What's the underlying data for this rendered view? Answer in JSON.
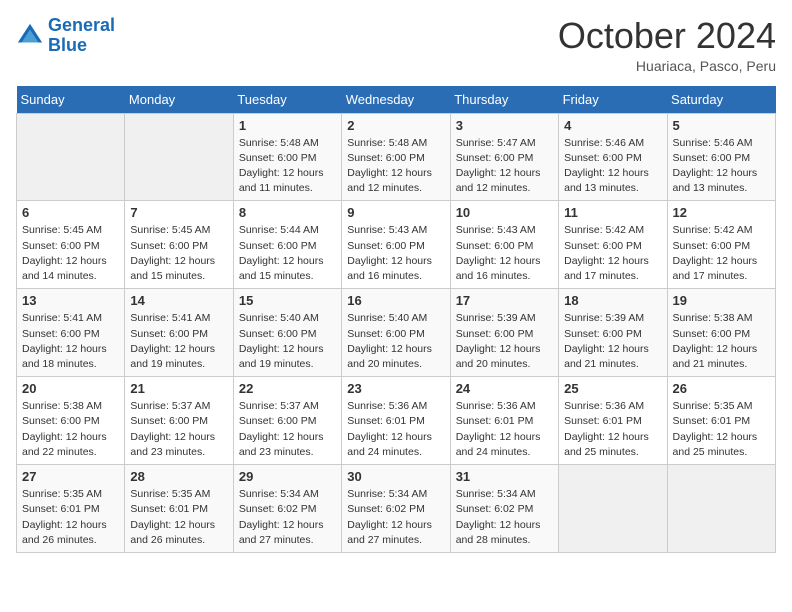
{
  "logo": {
    "line1": "General",
    "line2": "Blue"
  },
  "title": "October 2024",
  "subtitle": "Huariaca, Pasco, Peru",
  "days_header": [
    "Sunday",
    "Monday",
    "Tuesday",
    "Wednesday",
    "Thursday",
    "Friday",
    "Saturday"
  ],
  "weeks": [
    [
      {
        "num": "",
        "sunrise": "",
        "sunset": "",
        "daylight": ""
      },
      {
        "num": "",
        "sunrise": "",
        "sunset": "",
        "daylight": ""
      },
      {
        "num": "1",
        "sunrise": "Sunrise: 5:48 AM",
        "sunset": "Sunset: 6:00 PM",
        "daylight": "Daylight: 12 hours and 11 minutes."
      },
      {
        "num": "2",
        "sunrise": "Sunrise: 5:48 AM",
        "sunset": "Sunset: 6:00 PM",
        "daylight": "Daylight: 12 hours and 12 minutes."
      },
      {
        "num": "3",
        "sunrise": "Sunrise: 5:47 AM",
        "sunset": "Sunset: 6:00 PM",
        "daylight": "Daylight: 12 hours and 12 minutes."
      },
      {
        "num": "4",
        "sunrise": "Sunrise: 5:46 AM",
        "sunset": "Sunset: 6:00 PM",
        "daylight": "Daylight: 12 hours and 13 minutes."
      },
      {
        "num": "5",
        "sunrise": "Sunrise: 5:46 AM",
        "sunset": "Sunset: 6:00 PM",
        "daylight": "Daylight: 12 hours and 13 minutes."
      }
    ],
    [
      {
        "num": "6",
        "sunrise": "Sunrise: 5:45 AM",
        "sunset": "Sunset: 6:00 PM",
        "daylight": "Daylight: 12 hours and 14 minutes."
      },
      {
        "num": "7",
        "sunrise": "Sunrise: 5:45 AM",
        "sunset": "Sunset: 6:00 PM",
        "daylight": "Daylight: 12 hours and 15 minutes."
      },
      {
        "num": "8",
        "sunrise": "Sunrise: 5:44 AM",
        "sunset": "Sunset: 6:00 PM",
        "daylight": "Daylight: 12 hours and 15 minutes."
      },
      {
        "num": "9",
        "sunrise": "Sunrise: 5:43 AM",
        "sunset": "Sunset: 6:00 PM",
        "daylight": "Daylight: 12 hours and 16 minutes."
      },
      {
        "num": "10",
        "sunrise": "Sunrise: 5:43 AM",
        "sunset": "Sunset: 6:00 PM",
        "daylight": "Daylight: 12 hours and 16 minutes."
      },
      {
        "num": "11",
        "sunrise": "Sunrise: 5:42 AM",
        "sunset": "Sunset: 6:00 PM",
        "daylight": "Daylight: 12 hours and 17 minutes."
      },
      {
        "num": "12",
        "sunrise": "Sunrise: 5:42 AM",
        "sunset": "Sunset: 6:00 PM",
        "daylight": "Daylight: 12 hours and 17 minutes."
      }
    ],
    [
      {
        "num": "13",
        "sunrise": "Sunrise: 5:41 AM",
        "sunset": "Sunset: 6:00 PM",
        "daylight": "Daylight: 12 hours and 18 minutes."
      },
      {
        "num": "14",
        "sunrise": "Sunrise: 5:41 AM",
        "sunset": "Sunset: 6:00 PM",
        "daylight": "Daylight: 12 hours and 19 minutes."
      },
      {
        "num": "15",
        "sunrise": "Sunrise: 5:40 AM",
        "sunset": "Sunset: 6:00 PM",
        "daylight": "Daylight: 12 hours and 19 minutes."
      },
      {
        "num": "16",
        "sunrise": "Sunrise: 5:40 AM",
        "sunset": "Sunset: 6:00 PM",
        "daylight": "Daylight: 12 hours and 20 minutes."
      },
      {
        "num": "17",
        "sunrise": "Sunrise: 5:39 AM",
        "sunset": "Sunset: 6:00 PM",
        "daylight": "Daylight: 12 hours and 20 minutes."
      },
      {
        "num": "18",
        "sunrise": "Sunrise: 5:39 AM",
        "sunset": "Sunset: 6:00 PM",
        "daylight": "Daylight: 12 hours and 21 minutes."
      },
      {
        "num": "19",
        "sunrise": "Sunrise: 5:38 AM",
        "sunset": "Sunset: 6:00 PM",
        "daylight": "Daylight: 12 hours and 21 minutes."
      }
    ],
    [
      {
        "num": "20",
        "sunrise": "Sunrise: 5:38 AM",
        "sunset": "Sunset: 6:00 PM",
        "daylight": "Daylight: 12 hours and 22 minutes."
      },
      {
        "num": "21",
        "sunrise": "Sunrise: 5:37 AM",
        "sunset": "Sunset: 6:00 PM",
        "daylight": "Daylight: 12 hours and 23 minutes."
      },
      {
        "num": "22",
        "sunrise": "Sunrise: 5:37 AM",
        "sunset": "Sunset: 6:00 PM",
        "daylight": "Daylight: 12 hours and 23 minutes."
      },
      {
        "num": "23",
        "sunrise": "Sunrise: 5:36 AM",
        "sunset": "Sunset: 6:01 PM",
        "daylight": "Daylight: 12 hours and 24 minutes."
      },
      {
        "num": "24",
        "sunrise": "Sunrise: 5:36 AM",
        "sunset": "Sunset: 6:01 PM",
        "daylight": "Daylight: 12 hours and 24 minutes."
      },
      {
        "num": "25",
        "sunrise": "Sunrise: 5:36 AM",
        "sunset": "Sunset: 6:01 PM",
        "daylight": "Daylight: 12 hours and 25 minutes."
      },
      {
        "num": "26",
        "sunrise": "Sunrise: 5:35 AM",
        "sunset": "Sunset: 6:01 PM",
        "daylight": "Daylight: 12 hours and 25 minutes."
      }
    ],
    [
      {
        "num": "27",
        "sunrise": "Sunrise: 5:35 AM",
        "sunset": "Sunset: 6:01 PM",
        "daylight": "Daylight: 12 hours and 26 minutes."
      },
      {
        "num": "28",
        "sunrise": "Sunrise: 5:35 AM",
        "sunset": "Sunset: 6:01 PM",
        "daylight": "Daylight: 12 hours and 26 minutes."
      },
      {
        "num": "29",
        "sunrise": "Sunrise: 5:34 AM",
        "sunset": "Sunset: 6:02 PM",
        "daylight": "Daylight: 12 hours and 27 minutes."
      },
      {
        "num": "30",
        "sunrise": "Sunrise: 5:34 AM",
        "sunset": "Sunset: 6:02 PM",
        "daylight": "Daylight: 12 hours and 27 minutes."
      },
      {
        "num": "31",
        "sunrise": "Sunrise: 5:34 AM",
        "sunset": "Sunset: 6:02 PM",
        "daylight": "Daylight: 12 hours and 28 minutes."
      },
      {
        "num": "",
        "sunrise": "",
        "sunset": "",
        "daylight": ""
      },
      {
        "num": "",
        "sunrise": "",
        "sunset": "",
        "daylight": ""
      }
    ]
  ]
}
